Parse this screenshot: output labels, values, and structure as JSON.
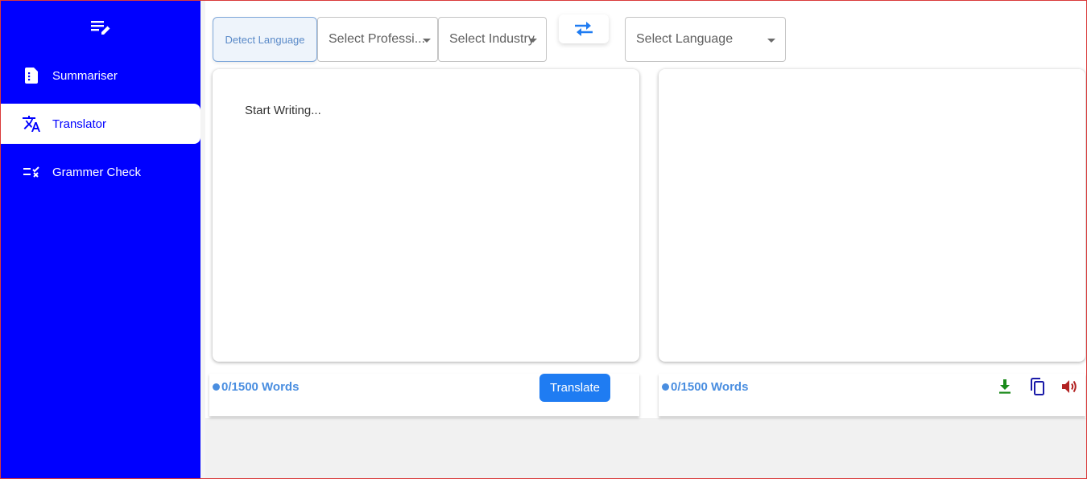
{
  "sidebar": {
    "logo_icon": "edit-note-icon",
    "items": [
      {
        "label": "Summariser",
        "icon": "document-icon",
        "active": false
      },
      {
        "label": "Translator",
        "icon": "translate-icon",
        "active": true
      },
      {
        "label": "Grammer Check",
        "icon": "rule-check-icon",
        "active": false
      }
    ],
    "background": "#0000ff"
  },
  "toolbar": {
    "detect_language_label": "Detect Language",
    "profession_placeholder": "Select Professi...",
    "industry_placeholder": "Select Industry",
    "language_placeholder": "Select Language",
    "swap_icon": "swap-arrows-icon"
  },
  "input_panel": {
    "placeholder": "Start Writing...",
    "word_count": "0/1500 Words",
    "translate_label": "Translate"
  },
  "output_panel": {
    "word_count": "0/1500 Words",
    "actions": [
      "download-icon",
      "copy-icon",
      "speaker-icon"
    ]
  },
  "colors": {
    "accent": "#1f7cf2",
    "word_count": "#4a8ee0",
    "download": "#1a8a1a",
    "copy": "#1a1aa8",
    "speaker": "#b22222"
  }
}
